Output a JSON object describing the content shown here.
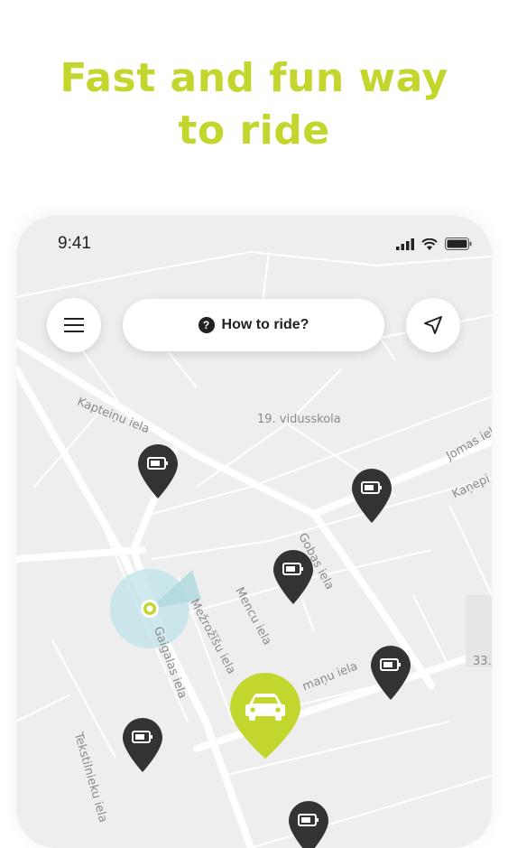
{
  "promo": {
    "line1": "Fast and fun way",
    "line2": "to ride"
  },
  "status_bar": {
    "time": "9:41",
    "icons": [
      "signal-icon",
      "wifi-icon",
      "battery-icon"
    ]
  },
  "toolbar": {
    "menu_icon": "hamburger-menu-icon",
    "how_to_ride_label": "How to ride?",
    "help_icon": "question-circle-icon",
    "locate_icon": "location-arrow-icon"
  },
  "map": {
    "streets": [
      "Kapteiņu iela",
      "19. vidusskola",
      "Jomas iela",
      "Kaņepi",
      "Gobas iela",
      "Mencu iela",
      "Mežrožīšu iela",
      "Gaigalas iela",
      "maņu iela",
      "Tekstilnieku iela",
      "33."
    ],
    "vehicle_pins": [
      "scooter",
      "scooter",
      "scooter",
      "scooter",
      "scooter",
      "scooter"
    ],
    "selected_pin": "car",
    "colors": {
      "accent": "#c3d62d",
      "pin": "#333333",
      "map_bg": "#eeeeee",
      "road": "#ffffff"
    }
  }
}
